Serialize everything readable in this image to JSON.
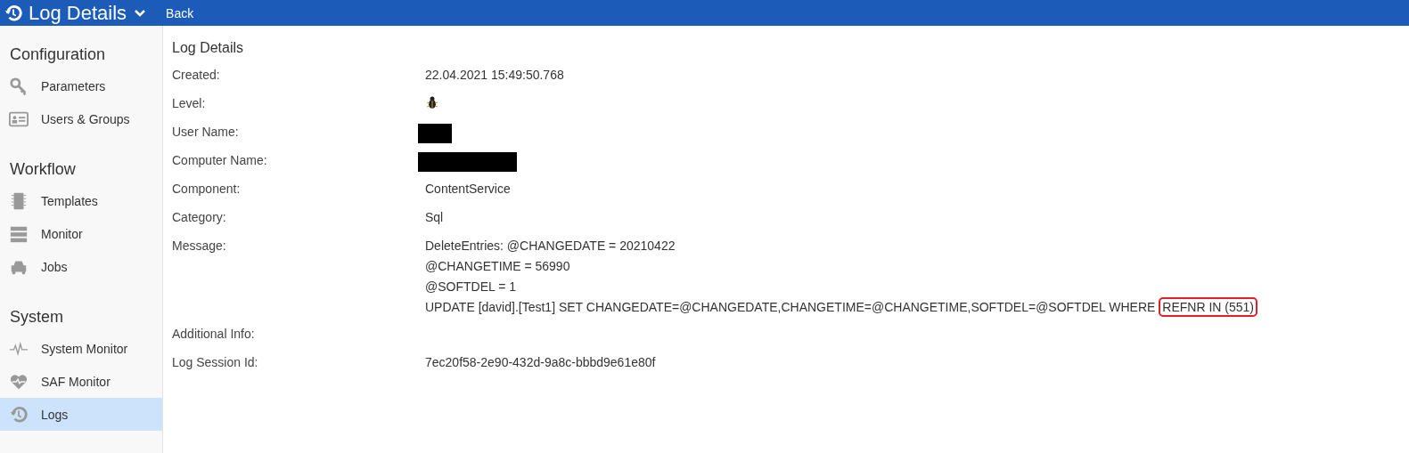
{
  "header": {
    "title": "Log Details",
    "back": "Back"
  },
  "sidebar": {
    "sections": [
      {
        "title": "Configuration",
        "items": [
          {
            "label": "Parameters",
            "selected": false
          },
          {
            "label": "Users & Groups",
            "selected": false
          }
        ]
      },
      {
        "title": "Workflow",
        "items": [
          {
            "label": "Templates",
            "selected": false
          },
          {
            "label": "Monitor",
            "selected": false
          },
          {
            "label": "Jobs",
            "selected": false
          }
        ]
      },
      {
        "title": "System",
        "items": [
          {
            "label": "System Monitor",
            "selected": false
          },
          {
            "label": "SAF Monitor",
            "selected": false
          },
          {
            "label": "Logs",
            "selected": true
          }
        ]
      }
    ]
  },
  "details": {
    "title": "Log Details",
    "fields": [
      {
        "label": "Created:",
        "kind": "text",
        "value": "22.04.2021 15:49:50.768"
      },
      {
        "label": "Level:",
        "kind": "bug"
      },
      {
        "label": "User Name:",
        "kind": "redacted"
      },
      {
        "label": "Computer Name:",
        "kind": "redacted"
      },
      {
        "label": "Component:",
        "kind": "text",
        "value": "ContentService"
      },
      {
        "label": "Category:",
        "kind": "text",
        "value": "Sql"
      },
      {
        "label": "Message:",
        "kind": "lines",
        "lines": [
          {
            "text": "DeleteEntries: @CHANGEDATE = 20210422"
          },
          {
            "text": "@CHANGETIME = 56990"
          },
          {
            "text": "@SOFTDEL = 1"
          },
          {
            "text": "UPDATE [david].[Test1] SET CHANGEDATE=@CHANGEDATE,CHANGETIME=@CHANGETIME,SOFTDEL=@SOFTDEL WHERE",
            "highlight": "REFNR IN (551)"
          }
        ]
      },
      {
        "label": "Additional Info:",
        "kind": "empty"
      },
      {
        "label": "Log Session Id:",
        "kind": "text",
        "value": "7ec20f58-2e90-432d-9a8c-bbbd9e61e80f"
      }
    ]
  }
}
